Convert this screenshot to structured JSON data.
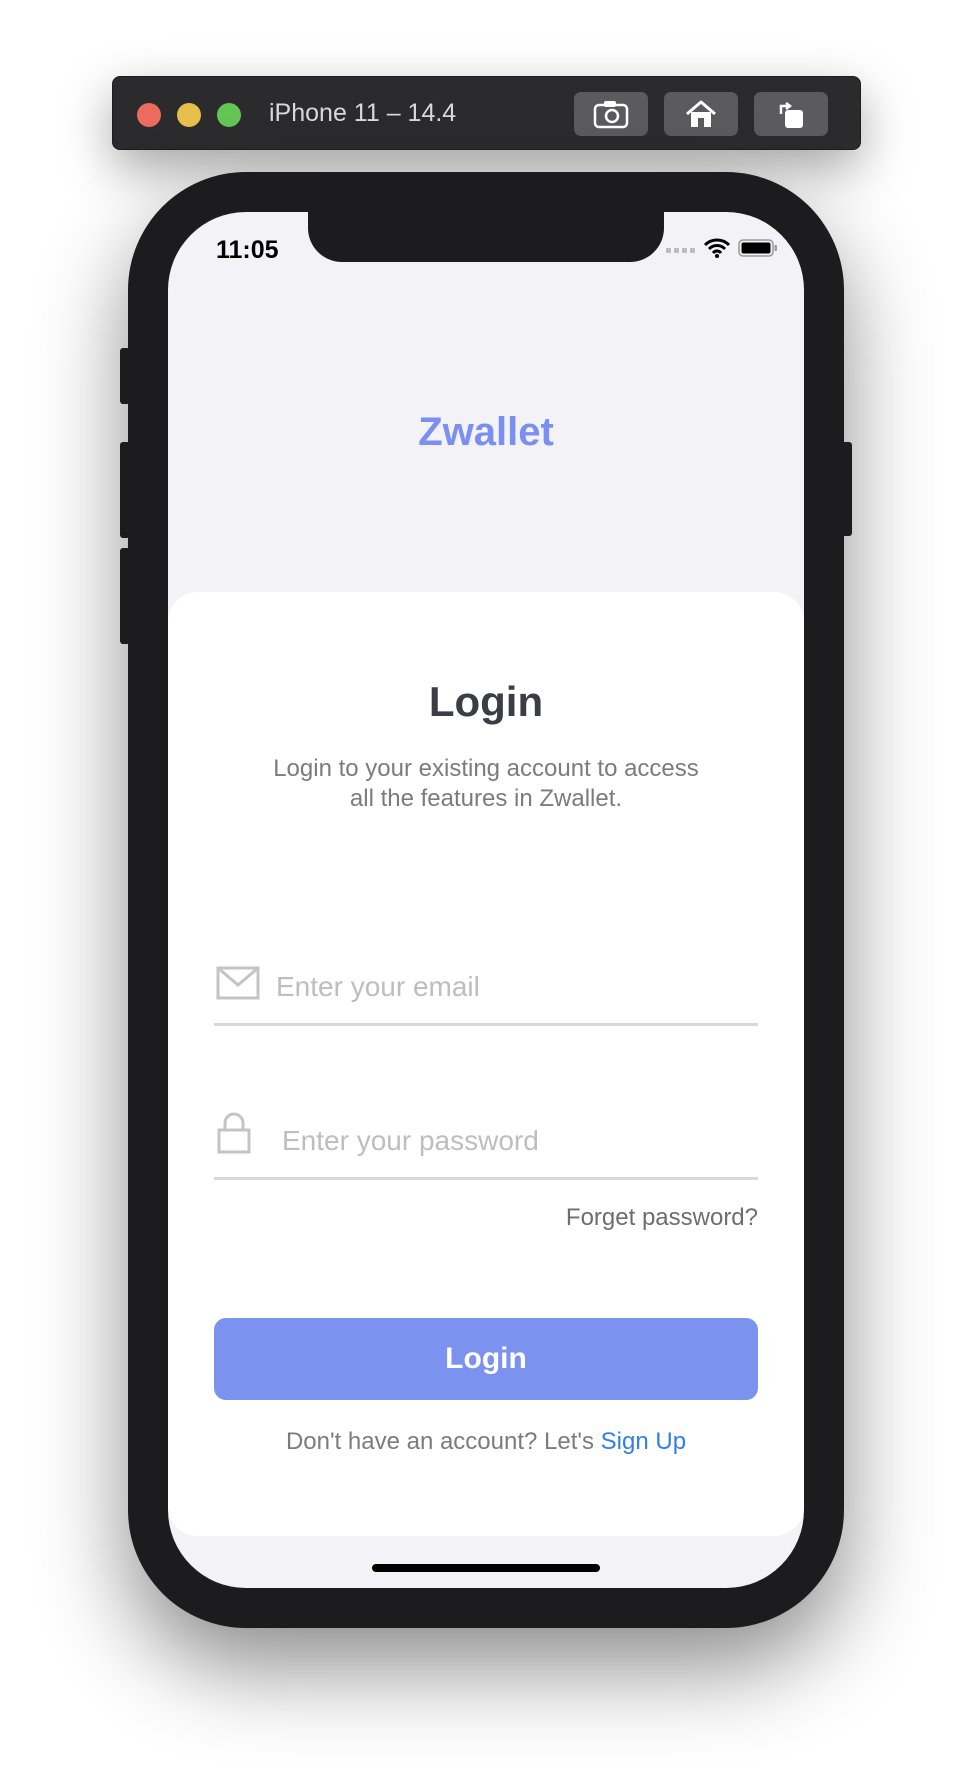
{
  "simulator": {
    "title": "iPhone 11 – 14.4",
    "buttons": [
      "screenshot-icon",
      "home-icon",
      "rotate-icon"
    ]
  },
  "status_bar": {
    "time": "11:05"
  },
  "app": {
    "brand": "Zwallet",
    "login": {
      "title": "Login",
      "subtitle_line1": "Login to your existing account to access",
      "subtitle_line2": "all the features in Zwallet.",
      "email_placeholder": "Enter your email",
      "password_placeholder": "Enter your password",
      "forget_password": "Forget password?",
      "login_button": "Login",
      "signup_prompt": "Don't have an account? Let's ",
      "signup_link": "Sign Up"
    }
  },
  "colors": {
    "accent": "#7b93ef",
    "brand": "#7a8ff0",
    "link": "#2f80ed"
  }
}
